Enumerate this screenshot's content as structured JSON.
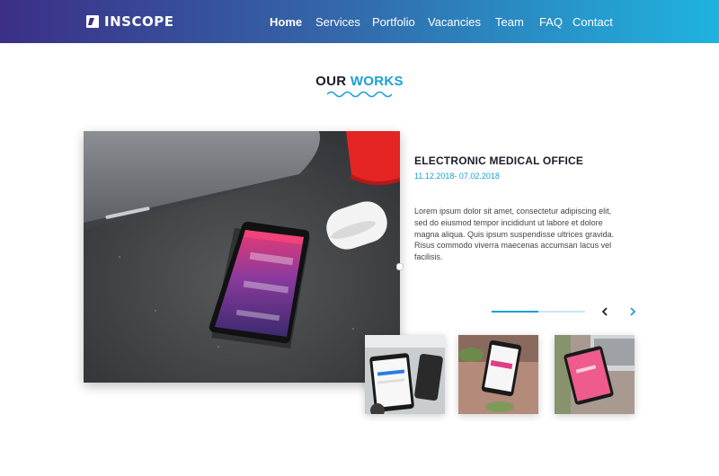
{
  "header": {
    "brand": "INSCOPE",
    "nav": [
      {
        "label": "Home",
        "active": true
      },
      {
        "label": "Services",
        "active": false
      },
      {
        "label": "Portfolio",
        "active": false
      },
      {
        "label": "Vacancies",
        "active": false
      },
      {
        "label": "Team",
        "active": false
      },
      {
        "label": "FAQ",
        "active": false
      },
      {
        "label": "Contact",
        "active": false
      }
    ],
    "gradient": [
      "#3b2f86",
      "#1fb3e0"
    ]
  },
  "works": {
    "title_main": "OUR",
    "title_accent": "WORKS",
    "accent_color": "#1aa0d8"
  },
  "project": {
    "title": "ELECTRONIC MEDICAL OFFICE",
    "date": "11.12.2018- 07.02.2018",
    "description": "Lorem ipsum dolor sit amet, consectetur adipiscing elit, sed do eiusmod tempor incididunt ut labore et dolore magna aliqua. Quis ipsum suspendisse ultrices gravida. Risus commodo viverra maecenas accumsan lacus vel facilisis."
  },
  "slider": {
    "progress": 0.5,
    "prev_icon": "chevron-left-icon",
    "next_icon": "chevron-right-icon"
  }
}
